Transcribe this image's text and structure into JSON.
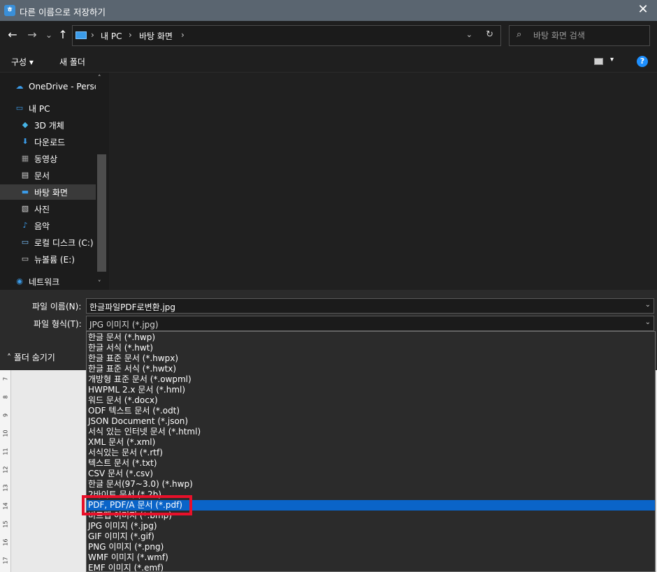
{
  "window": {
    "icon_glyph": "ㅎ",
    "title": "다른 이름으로 저장하기",
    "close_glyph": "✕"
  },
  "nav": {
    "back_glyph": "←",
    "forward_glyph": "→",
    "history_glyph": "⌄",
    "up_glyph": "↑",
    "breadcrumb": [
      "내 PC",
      "바탕 화면"
    ],
    "separator": "›",
    "dropdown_glyph": "⌄",
    "refresh_glyph": "↻",
    "search_placeholder": "바탕 화면 검색",
    "search_glyph": "⌕"
  },
  "toolbar": {
    "organize_label": "구성 ▾",
    "new_folder_label": "새 폴더",
    "view_caret": "▾",
    "help_label": "?"
  },
  "sidebar": {
    "items": [
      {
        "label": "OneDrive - Personal",
        "icon": "cloud-icon",
        "glyph": "☁",
        "color": "#3b9be8"
      },
      {
        "label": "내 PC",
        "icon": "computer-icon",
        "glyph": "▭",
        "color": "#3b9be8"
      },
      {
        "label": "3D 개체",
        "icon": "cube-icon",
        "glyph": "◆",
        "color": "#46b4e6"
      },
      {
        "label": "다운로드",
        "icon": "download-icon",
        "glyph": "⬇",
        "color": "#3b9be8"
      },
      {
        "label": "동영상",
        "icon": "video-icon",
        "glyph": "▦",
        "color": "#9a9a9a"
      },
      {
        "label": "문서",
        "icon": "document-icon",
        "glyph": "▤",
        "color": "#d8d8d8"
      },
      {
        "label": "바탕 화면",
        "icon": "desktop-icon",
        "glyph": "▬",
        "color": "#3b9be8"
      },
      {
        "label": "사진",
        "icon": "picture-icon",
        "glyph": "▧",
        "color": "#d8d8d8"
      },
      {
        "label": "음악",
        "icon": "music-icon",
        "glyph": "♪",
        "color": "#3b9be8"
      },
      {
        "label": "로컬 디스크 (C:)",
        "icon": "drive-icon",
        "glyph": "▭",
        "color": "#7cc3ff"
      },
      {
        "label": "뉴볼륨 (E:)",
        "icon": "drive-icon",
        "glyph": "▭",
        "color": "#d8d8d8"
      },
      {
        "label": "네트워크",
        "icon": "network-icon",
        "glyph": "◉",
        "color": "#3b9be8"
      }
    ],
    "selected_index": 6,
    "scroll_up": "˄",
    "scroll_down": "˅"
  },
  "form": {
    "filename_label": "파일 이름(N):",
    "filename_value": "한글파일PDF로변환.jpg",
    "filetype_label": "파일 형식(T):",
    "filetype_value": "JPG 이미지 (*.jpg)",
    "caret": "⌄",
    "hide_folders_label": "˄  폴더 숨기기"
  },
  "ruler": {
    "numbers": [
      "7",
      "8",
      "9",
      "10",
      "11",
      "12",
      "13",
      "14",
      "15",
      "16",
      "17"
    ]
  },
  "dropdown": {
    "options": [
      "한글 문서 (*.hwp)",
      "한글 서식 (*.hwt)",
      "한글 표준 문서 (*.hwpx)",
      "한글 표준 서식 (*.hwtx)",
      "개방형 표준 문서 (*.owpml)",
      "HWPML 2.x 문서 (*.hml)",
      "워드 문서 (*.docx)",
      "ODF 텍스트 문서 (*.odt)",
      "JSON Document (*.json)",
      "서식 있는 인터넷 문서 (*.html)",
      "XML 문서 (*.xml)",
      "서식있는 문서 (*.rtf)",
      "텍스트 문서 (*.txt)",
      "CSV 문서 (*.csv)",
      "한글 문서(97~3.0) (*.hwp)",
      "2바이트 문서 (*.2b)",
      "PDF, PDF/A 문서 (*.pdf)",
      "비트맵 이미지 (*.bmp)",
      "JPG 이미지 (*.jpg)",
      "GIF 이미지 (*.gif)",
      "PNG 이미지 (*.png)",
      "WMF 이미지 (*.wmf)",
      "EMF 이미지 (*.emf)"
    ],
    "highlighted_index": 16,
    "highlight_color": "#0a64c8",
    "annotation_color": "#e8102a"
  }
}
